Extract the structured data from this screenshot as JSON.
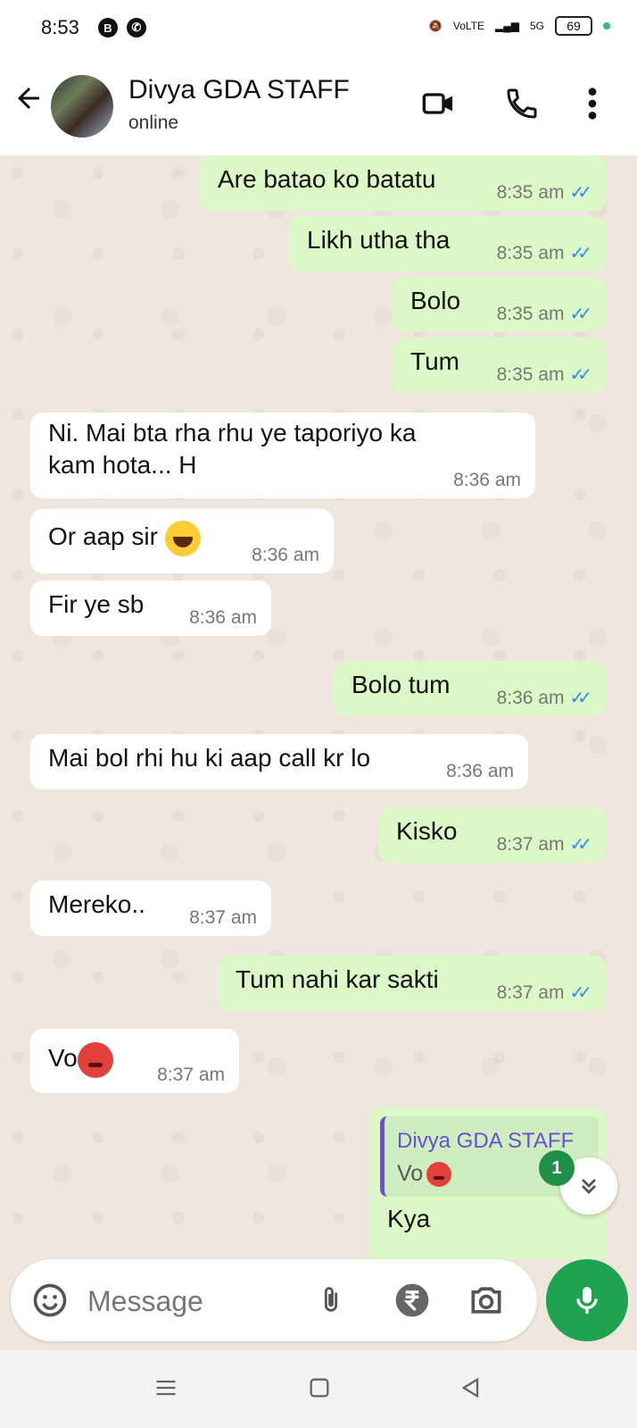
{
  "status_bar": {
    "time": "8:53",
    "battery": "69",
    "network": "5G",
    "volte": "VoLTE"
  },
  "header": {
    "name": "Divya GDA STAFF",
    "status": "online"
  },
  "messages": [
    {
      "text": "Are batao ko batatu",
      "time": "8:35 am"
    },
    {
      "text": "Likh utha tha",
      "time": "8:35 am"
    },
    {
      "text": "Bolo",
      "time": "8:35 am"
    },
    {
      "text": "Tum",
      "time": "8:35 am"
    },
    {
      "line1": "Ni. Mai bta rha rhu ye taporiyo ka",
      "line2": "kam hota... H",
      "time": "8:36 am"
    },
    {
      "text": "Or aap sir",
      "time": "8:36 am"
    },
    {
      "text": "Fir ye sb",
      "time": "8:36 am"
    },
    {
      "text": "Bolo tum",
      "time": "8:36 am"
    },
    {
      "text": "Mai bol rhi hu ki aap call kr lo",
      "time": "8:36 am"
    },
    {
      "text": "Kisko",
      "time": "8:37 am"
    },
    {
      "text": "Mereko..",
      "time": "8:37 am"
    },
    {
      "text": "Tum nahi kar sakti",
      "time": "8:37 am"
    },
    {
      "text": "Vo",
      "time": "8:37 am"
    },
    {
      "reply_name": "Divya GDA STAFF",
      "reply_text": "Vo",
      "text": "Kya"
    }
  ],
  "unread_count": "1",
  "composer": {
    "placeholder": "Message"
  }
}
